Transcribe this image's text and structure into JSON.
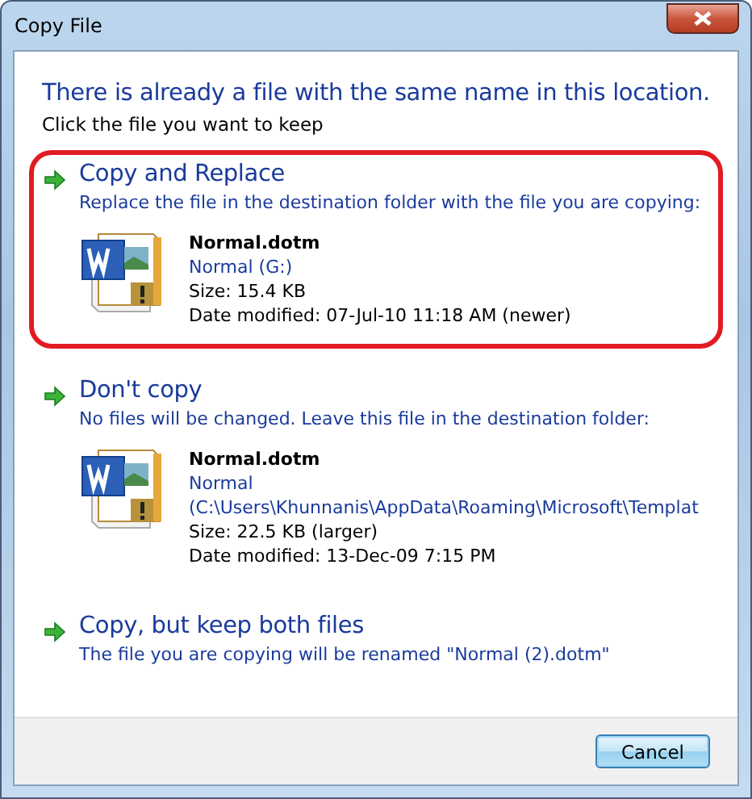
{
  "window": {
    "title": "Copy File"
  },
  "heading": "There is already a file with the same name in this location.",
  "instruction": "Click the file you want to keep",
  "options": [
    {
      "title": "Copy and Replace",
      "description": "Replace the file in the destination folder with the file you are copying:",
      "highlighted": true,
      "file": {
        "name": "Normal.dotm",
        "location": [
          "Normal (G:)"
        ],
        "size": "Size: 15.4 KB",
        "modified": "Date modified: 07-Jul-10 11:18 AM (newer)"
      }
    },
    {
      "title": "Don't copy",
      "description": "No files will be changed. Leave this file in the destination folder:",
      "highlighted": false,
      "file": {
        "name": "Normal.dotm",
        "location": [
          "Normal",
          "(C:\\Users\\Khunnanis\\AppData\\Roaming\\Microsoft\\Templat"
        ],
        "size": "Size: 22.5 KB (larger)",
        "modified": "Date modified: 13-Dec-09 7:15 PM"
      }
    },
    {
      "title": "Copy, but keep both files",
      "description": "The file you are copying will be renamed \"Normal (2).dotm\"",
      "highlighted": false
    }
  ],
  "buttons": [
    {
      "label": "Cancel"
    }
  ]
}
